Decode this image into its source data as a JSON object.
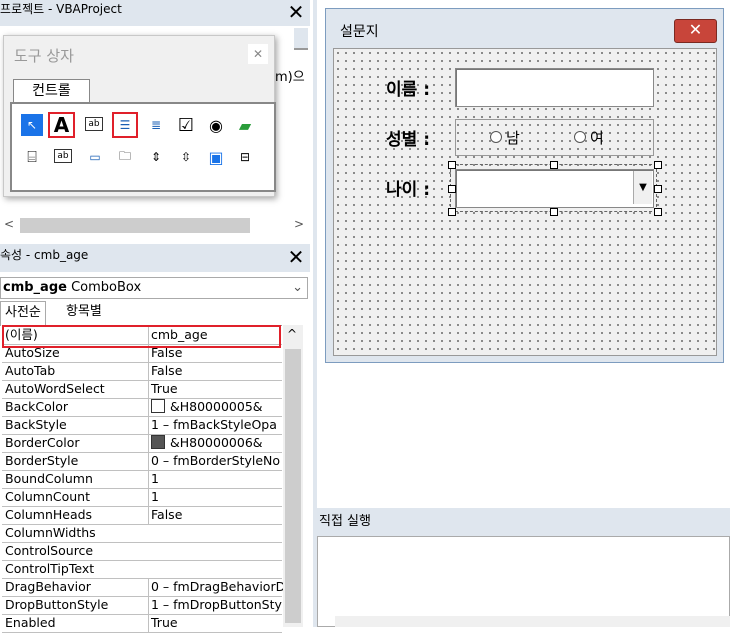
{
  "project": {
    "title": "프로젝트 - VBAProject",
    "code_snippet": "m)으"
  },
  "toolbox": {
    "title": "도구 상자",
    "tab": "컨트롤",
    "tools_row1": [
      {
        "icon": "select-objects-icon",
        "glyph": "↖"
      },
      {
        "icon": "label-tool-icon",
        "glyph": "A"
      },
      {
        "icon": "textbox-tool-icon",
        "glyph": "ab"
      },
      {
        "icon": "combobox-tool-icon",
        "glyph": "☰"
      },
      {
        "icon": "listbox-tool-icon",
        "glyph": "≣"
      },
      {
        "icon": "checkbox-tool-icon",
        "glyph": "☑"
      },
      {
        "icon": "optionbutton-tool-icon",
        "glyph": "◉"
      },
      {
        "icon": "togglebutton-tool-icon",
        "glyph": "▰"
      }
    ],
    "tools_row2": [
      {
        "icon": "frame-tool-icon",
        "glyph": "⌸"
      },
      {
        "icon": "commandbutton-tool-icon",
        "glyph": "ab"
      },
      {
        "icon": "tabstrip-tool-icon",
        "glyph": "▭"
      },
      {
        "icon": "multipage-tool-icon",
        "glyph": "🗀"
      },
      {
        "icon": "scrollbar-tool-icon",
        "glyph": "⇕"
      },
      {
        "icon": "spinbutton-tool-icon",
        "glyph": "⇳"
      },
      {
        "icon": "image-tool-icon",
        "glyph": "▣"
      },
      {
        "icon": "refedit-tool-icon",
        "glyph": "⊟"
      }
    ]
  },
  "properties": {
    "title": "속성 - cmb_age",
    "object_name": "cmb_age",
    "object_type": "ComboBox",
    "tab_alpha": "사전순",
    "tab_category": "항목별",
    "rows": [
      {
        "name": "(이름)",
        "value": "cmb_age"
      },
      {
        "name": "AutoSize",
        "value": "False"
      },
      {
        "name": "AutoTab",
        "value": "False"
      },
      {
        "name": "AutoWordSelect",
        "value": "True"
      },
      {
        "name": "BackColor",
        "value": "&H80000005&"
      },
      {
        "name": "BackStyle",
        "value": "1 – fmBackStyleOpa"
      },
      {
        "name": "BorderColor",
        "value": "&H80000006&"
      },
      {
        "name": "BorderStyle",
        "value": "0 – fmBorderStyleNo"
      },
      {
        "name": "BoundColumn",
        "value": "1"
      },
      {
        "name": "ColumnCount",
        "value": "1"
      },
      {
        "name": "ColumnHeads",
        "value": "False"
      },
      {
        "name": "ColumnWidths",
        "value": ""
      },
      {
        "name": "ControlSource",
        "value": ""
      },
      {
        "name": "ControlTipText",
        "value": ""
      },
      {
        "name": "DragBehavior",
        "value": "0 – fmDragBehaviorD"
      },
      {
        "name": "DropButtonStyle",
        "value": "1 – fmDropButtonSty"
      },
      {
        "name": "Enabled",
        "value": "True"
      }
    ],
    "swatch_colors": {
      "BackColor": "#ffffff",
      "BorderColor": "#555555"
    }
  },
  "userform": {
    "title": "설문지",
    "name_label": "이름 :",
    "gender_label": "성별 :",
    "gender_male": "남",
    "gender_female": "여",
    "age_label": "나이 :"
  },
  "immediate": {
    "title": "직접 실행"
  },
  "colors": {
    "highlight_red": "#e0202a",
    "pane_title": "#dfe6ee",
    "tool_selected": "#1a73e8"
  }
}
